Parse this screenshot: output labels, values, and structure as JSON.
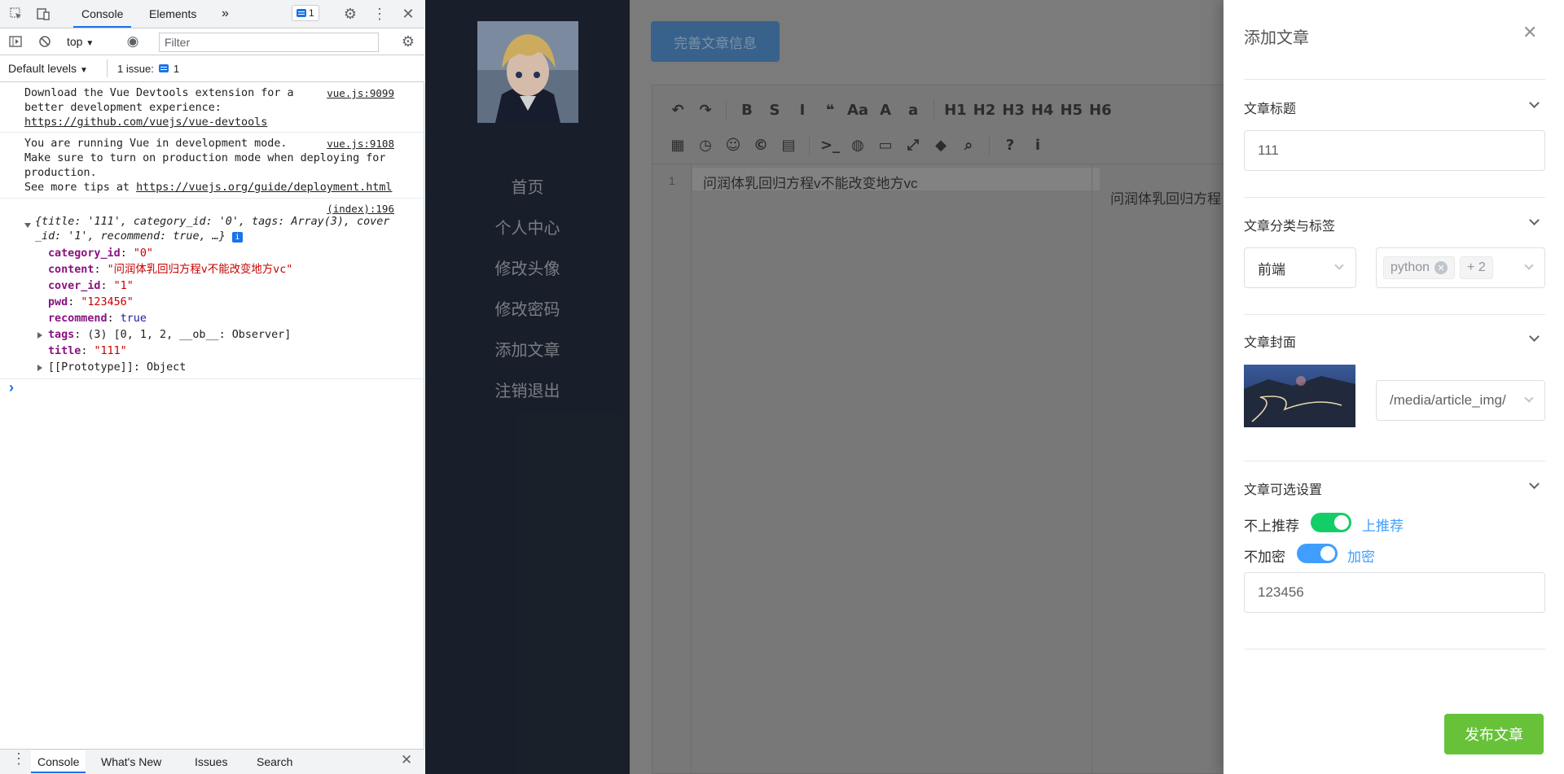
{
  "devtools": {
    "tabs": [
      "Console",
      "Elements"
    ],
    "more_tabs": "»",
    "issues_badge": "1",
    "context": "top",
    "filter_placeholder": "Filter",
    "levels": "Default levels",
    "issue_count": "1 issue:",
    "issue_badge": "1",
    "messages": [
      {
        "text": "Download the Vue Devtools extension for a\nbetter development experience:",
        "link": "https://github.com/vuejs/vue-devtools",
        "source": "vue.js:9099"
      },
      {
        "text": "You are running Vue in development mode.\nMake sure to turn on production mode when deploying for\nproduction.\nSee more tips at",
        "link": "https://vuejs.org/guide/deployment.html",
        "source": "vue.js:9108"
      }
    ],
    "object_log": {
      "source": "(index):196",
      "preview_line1": "{title: '111', category_id: '0', tags: Array(3), cover",
      "preview_line2": "_id: '1', recommend: true, …}",
      "props": [
        {
          "key": "category_id",
          "value": "\"0\"",
          "kind": "string"
        },
        {
          "key": "content",
          "value": "\"问润体乳回归方程v不能改变地方vc\"",
          "kind": "string"
        },
        {
          "key": "cover_id",
          "value": "\"1\"",
          "kind": "string"
        },
        {
          "key": "pwd",
          "value": "\"123456\"",
          "kind": "string"
        },
        {
          "key": "recommend",
          "value": "true",
          "kind": "bool"
        }
      ],
      "tags_key": "tags",
      "tags_value": "(3) [0, 1, 2, __ob__: Observer]",
      "title_key": "title",
      "title_value": "\"111\"",
      "proto_key": "[[Prototype]]",
      "proto_value": "Object"
    },
    "prompt": "›",
    "drawer_tabs": [
      "Console",
      "What's New",
      "Issues",
      "Search"
    ]
  },
  "app": {
    "nav": [
      "首页",
      "个人中心",
      "修改头像",
      "修改密码",
      "添加文章",
      "注销退出"
    ],
    "info_button": "完善文章信息",
    "toolbar_row1": [
      "↶",
      "↷",
      "B",
      "S",
      "I",
      "❝",
      "Aa",
      "A",
      "a",
      "H1",
      "H2",
      "H3",
      "H4",
      "H5",
      "H6"
    ],
    "toolbar_row2": [
      "▦",
      "◷",
      "☺",
      "©",
      "▤",
      ">_",
      "◍",
      "▭",
      "⤢",
      "◆",
      "⌕",
      "?",
      "i"
    ],
    "editor_line_no": "1",
    "editor_text": "问润体乳回归方程v不能改变地方vc",
    "preview_text": "问润体乳回归方程"
  },
  "drawer": {
    "title": "添加文章",
    "close": "✕",
    "sections": {
      "title_label": "文章标题",
      "title_value": "111",
      "category_label": "文章分类与标签",
      "category_value": "前端",
      "tag_value": "python",
      "tag_more": "+ 2",
      "cover_label": "文章封面",
      "cover_path": "/media/article_img/",
      "options_label": "文章可选设置",
      "recommend_off": "不上推荐",
      "recommend_on": "上推荐",
      "encrypt_off": "不加密",
      "encrypt_on": "加密",
      "pwd_value": "123456"
    },
    "publish_button": "发布文章",
    "colors": {
      "switch_green": "#13ce66",
      "switch_blue": "#409eff",
      "publish": "#67c23a"
    }
  }
}
